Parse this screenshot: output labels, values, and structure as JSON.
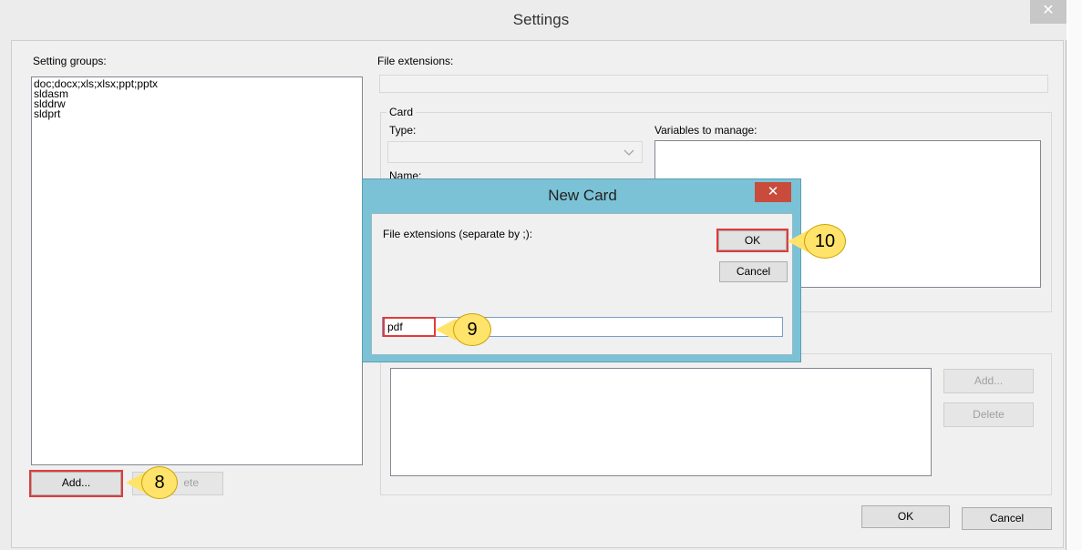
{
  "settings": {
    "title": "Settings",
    "close_symbol": "✕",
    "setting_groups_label": "Setting groups:",
    "setting_groups": [
      "doc;docx;xls;xlsx;ppt;pptx",
      "sldasm",
      "slddrw",
      "sldprt"
    ],
    "add_button": "Add...",
    "delete_button": "ete",
    "file_extensions_label": "File extensions:",
    "card_group_label": "Card",
    "type_label": "Type:",
    "name_label": "Name:",
    "variables_label": "Variables to manage:",
    "right_add_button": "Add...",
    "right_delete_button": "Delete",
    "ok_button": "OK",
    "cancel_button": "Cancel"
  },
  "new_card": {
    "title": "New Card",
    "close_symbol": "✕",
    "prompt": "File extensions (separate by ;):",
    "ok_button": "OK",
    "cancel_button": "Cancel",
    "input_value": "pdf"
  },
  "callouts": {
    "step8": "8",
    "step9": "9",
    "step10": "10"
  },
  "colors": {
    "dialog_frame": "#7cc2d6",
    "callout": "#ffe36a",
    "highlight": "#e03b3b",
    "close_red": "#c94b3b"
  },
  "icons": {
    "dropdown": "chevron-down-icon",
    "close": "close-icon"
  }
}
